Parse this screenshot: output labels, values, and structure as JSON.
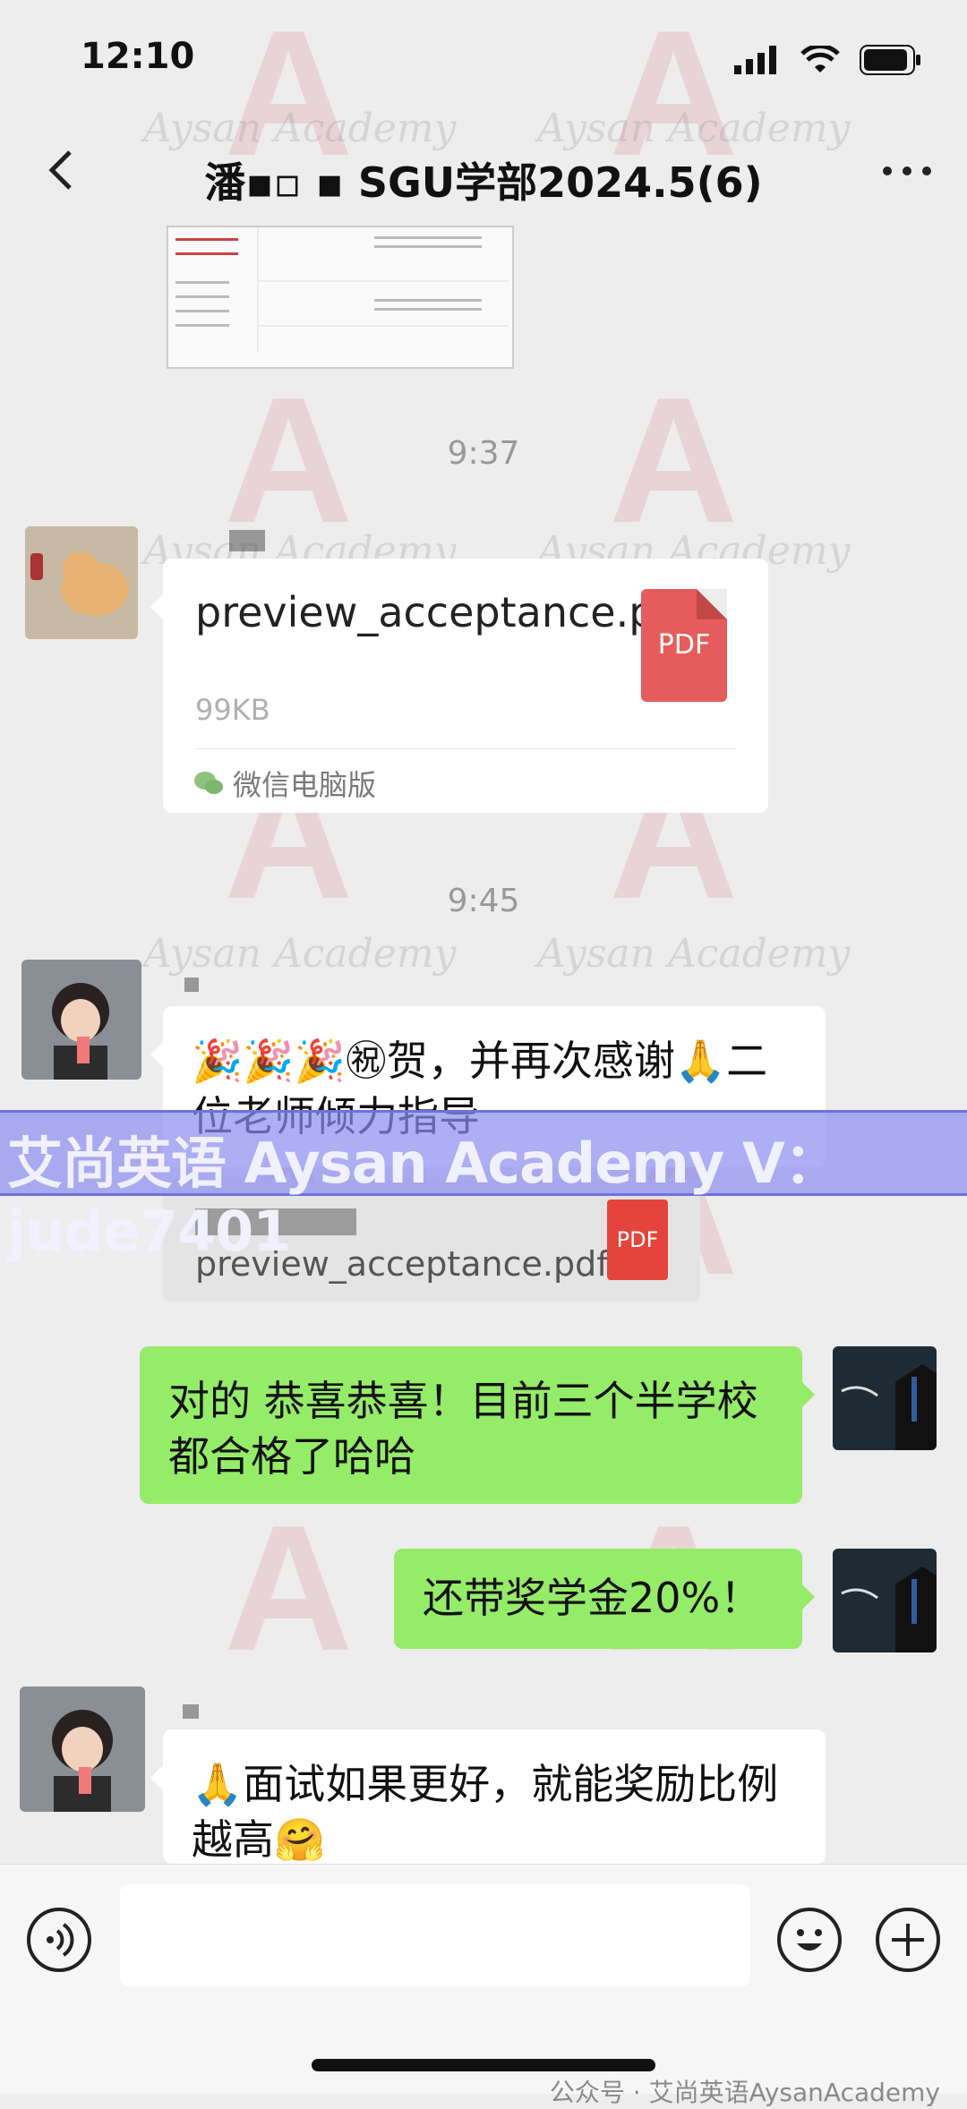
{
  "status": {
    "time": "12:10"
  },
  "nav": {
    "title": "潘▪▫ ▪ SGU学部2024.5(6)"
  },
  "timestamps": [
    "9:37",
    "9:45"
  ],
  "file_message": {
    "name": "preview_acceptance.pdf",
    "size": "99KB",
    "pdf_label": "PDF",
    "source": "微信电脑版"
  },
  "msg1": {
    "text": "🎉🎉🎉㊗贺，并再次感谢🙏二位老师倾力指导"
  },
  "quote": {
    "file": "preview_acceptance.pdf",
    "pdf_label": "PDF"
  },
  "banner": {
    "text": "艾尚英语 Aysan Academy V：jude7401"
  },
  "msg2": {
    "text": "对的 恭喜恭喜！目前三个半学校都合格了哈哈"
  },
  "msg3": {
    "text": "还带奖学金20%！"
  },
  "msg4": {
    "text": "🙏面试如果更好，就能奖励比例越高🤗"
  },
  "watermark": {
    "text": "Aysan Academy"
  },
  "footer": {
    "text": "公众号 · 艾尚英语AysanAcademy"
  },
  "icons": [
    "back-icon",
    "more-icon",
    "voice-icon",
    "emoji-icon",
    "plus-icon",
    "pdf-icon",
    "wechat-pc-icon"
  ]
}
